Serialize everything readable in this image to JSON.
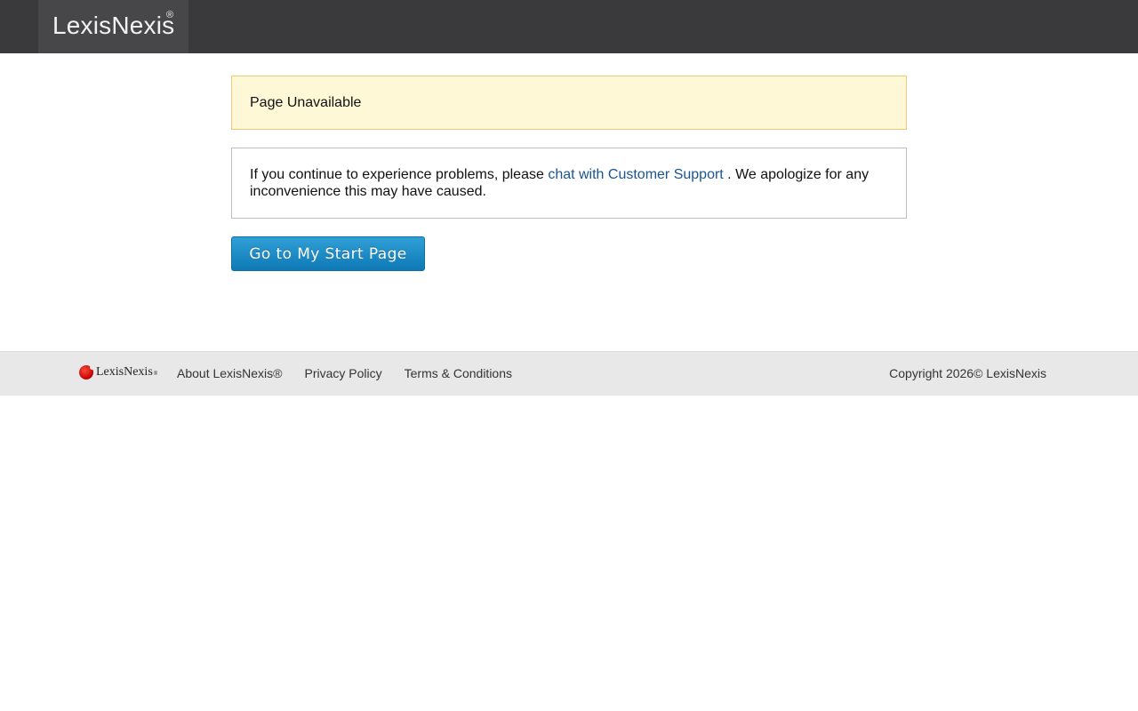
{
  "header": {
    "logo_text": "LexisNexis",
    "logo_reg": "®"
  },
  "alert": {
    "title": "Page Unavailable"
  },
  "message": {
    "text_before": "If you continue to experience problems, please ",
    "link_text": "chat with Customer Support",
    "text_after": " . We apologize for any inconvenience this may have caused."
  },
  "start_button": {
    "label": "Go to My Start Page"
  },
  "footer": {
    "logo_text": "LexisNexis",
    "logo_reg": "®",
    "links": [
      {
        "label": "About LexisNexis®"
      },
      {
        "label": "Privacy Policy"
      },
      {
        "label": "Terms & Conditions"
      }
    ],
    "copyright": "Copyright 2026© LexisNexis"
  },
  "colors": {
    "header_bg": "#3a3a3c",
    "alert_bg": "#fef8d6",
    "alert_border": "#f0c97a",
    "link": "#1a5592",
    "button": "#1a8cc8",
    "footer_bg": "#e8e8e8"
  }
}
